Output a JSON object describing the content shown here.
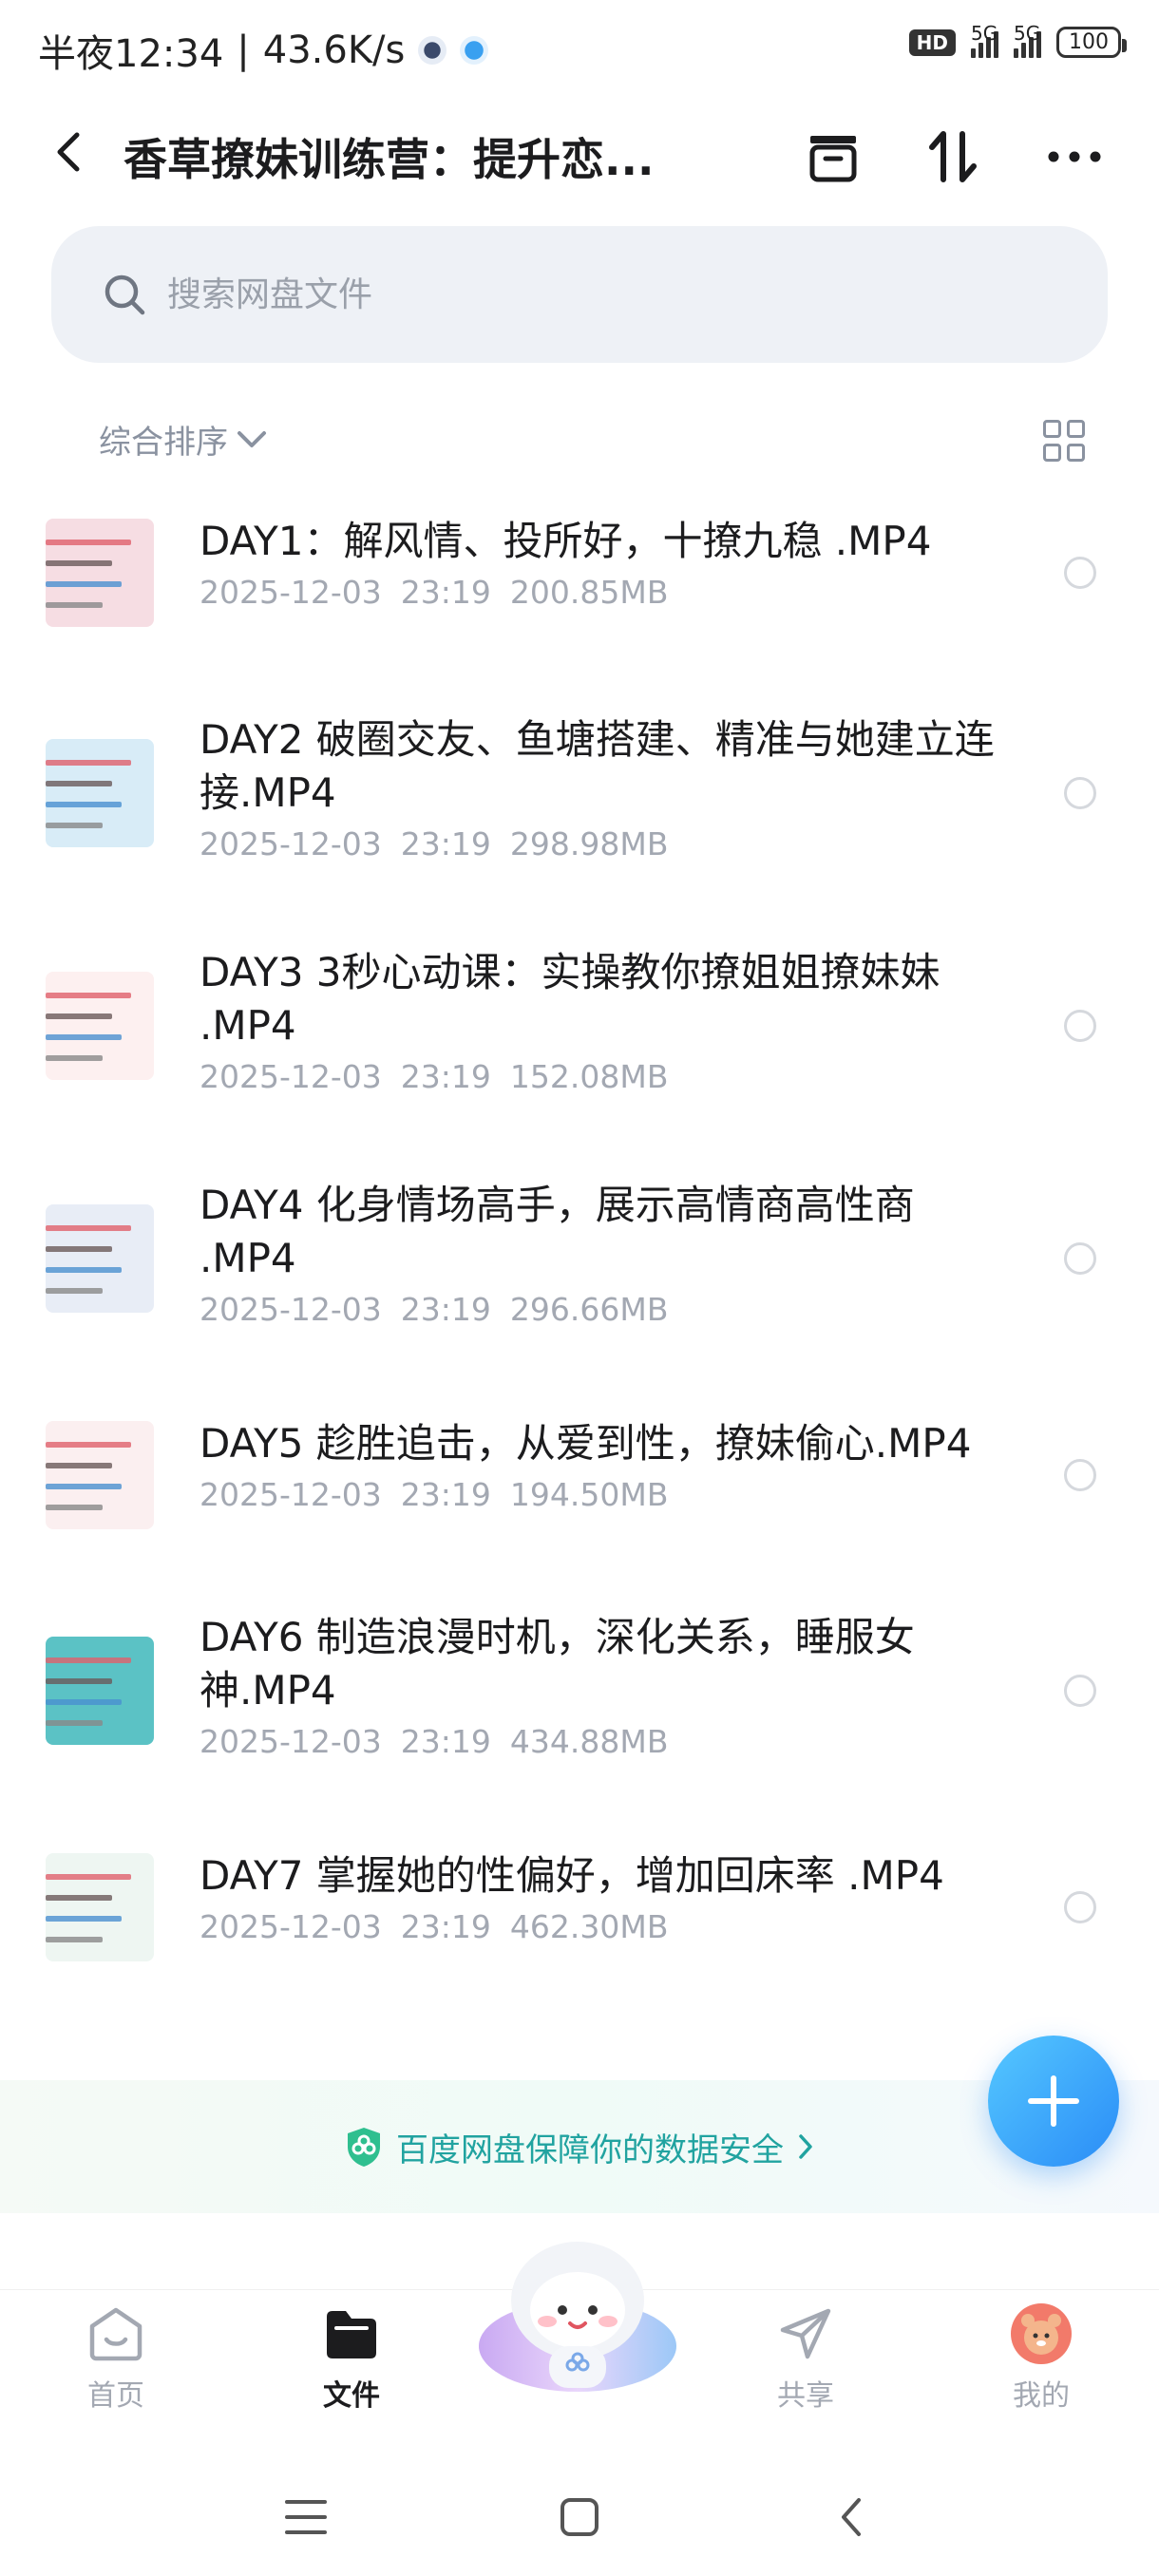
{
  "status_bar": {
    "time": "半夜12:34",
    "speed": "43.6K/s",
    "hd": "HD",
    "sig1": "5G",
    "sig2": "5G",
    "battery": "100"
  },
  "header": {
    "title": "香草撩妹训练营：提升恋..."
  },
  "search": {
    "placeholder": "搜索网盘文件"
  },
  "sort": {
    "label": "综合排序"
  },
  "files": [
    {
      "name": "DAY1：解风情、投所好，十撩九稳 .MP4",
      "date": "2025-12-03",
      "time": "23:19",
      "size": "200.85MB",
      "thumb_color": "#f6dde3"
    },
    {
      "name": "DAY2 破圈交友、鱼塘搭建、精准与她建立连接.MP4",
      "date": "2025-12-03",
      "time": "23:19",
      "size": "298.98MB",
      "thumb_color": "#d8ecf7"
    },
    {
      "name": "DAY3 3秒心动课：实操教你撩姐姐撩妹妹 .MP4",
      "date": "2025-12-03",
      "time": "23:19",
      "size": "152.08MB",
      "thumb_color": "#fdf0f0"
    },
    {
      "name": "DAY4 化身情场高手，展示高情商高性商 .MP4",
      "date": "2025-12-03",
      "time": "23:19",
      "size": "296.66MB",
      "thumb_color": "#e8edf6"
    },
    {
      "name": "DAY5 趁胜追击，从爱到性，撩妹偷心.MP4",
      "date": "2025-12-03",
      "time": "23:19",
      "size": "194.50MB",
      "thumb_color": "#fbeff0"
    },
    {
      "name": "DAY6 制造浪漫时机，深化关系，睡服女神.MP4",
      "date": "2025-12-03",
      "time": "23:19",
      "size": "434.88MB",
      "thumb_color": "#5bc2c5"
    },
    {
      "name": "DAY7 掌握她的性偏好，增加回床率 .MP4",
      "date": "2025-12-03",
      "time": "23:19",
      "size": "462.30MB",
      "thumb_color": "#eef6f2"
    }
  ],
  "banner": {
    "text": "百度网盘保障你的数据安全"
  },
  "nav": {
    "home": "首页",
    "files": "文件",
    "share": "共享",
    "me": "我的"
  },
  "colors": {
    "accent": "#2a8cf7",
    "secure": "#21a3a0"
  }
}
